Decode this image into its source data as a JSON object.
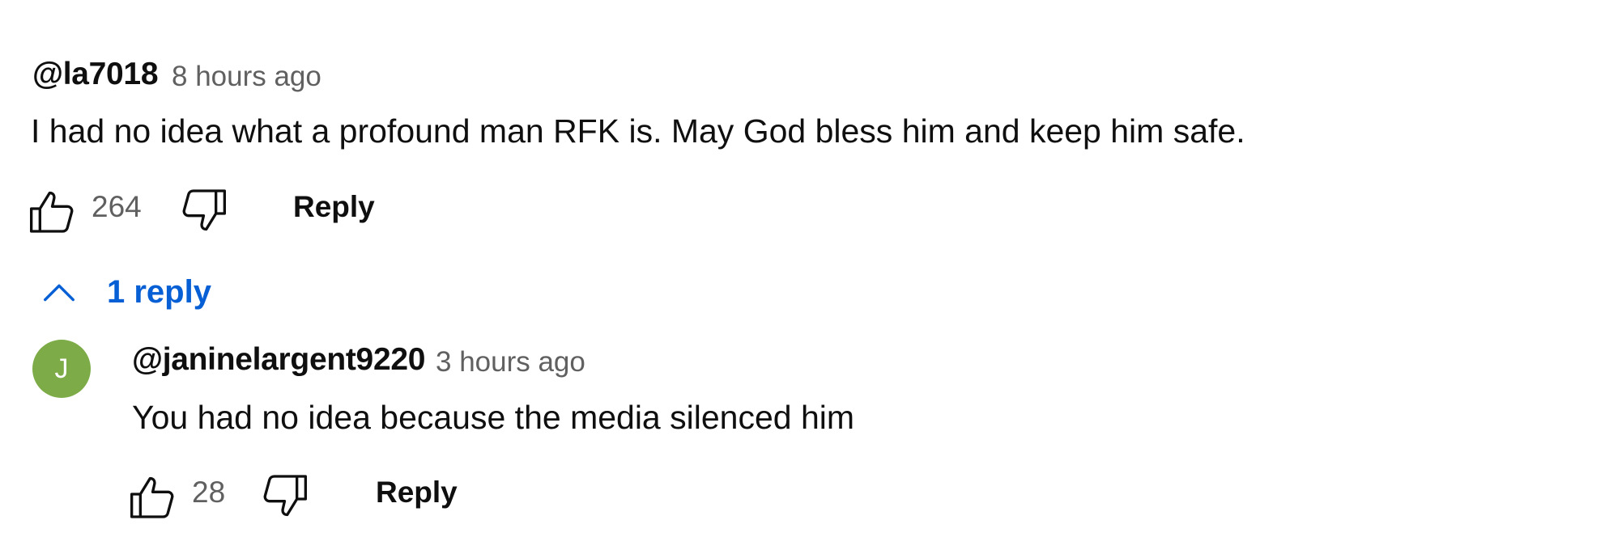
{
  "comment": {
    "author": "@la7018",
    "time": "8 hours ago",
    "text": "I had no idea what a profound man RFK is. May God bless him and keep him safe.",
    "like_count": "264",
    "reply_label": "Reply",
    "replies_toggle_label": "1 reply"
  },
  "reply": {
    "avatar_letter": "J",
    "avatar_color": "#7cab47",
    "author": "@janinelargent9220",
    "time": "3 hours ago",
    "text": "You had no idea because the media silenced him",
    "like_count": "28",
    "reply_label": "Reply"
  },
  "colors": {
    "link_blue": "#065fd4",
    "secondary_text": "#606060",
    "primary_text": "#0f0f0f"
  },
  "icons": {
    "like": "thumbs-up-icon",
    "dislike": "thumbs-down-icon",
    "collapse": "chevron-up-icon"
  }
}
